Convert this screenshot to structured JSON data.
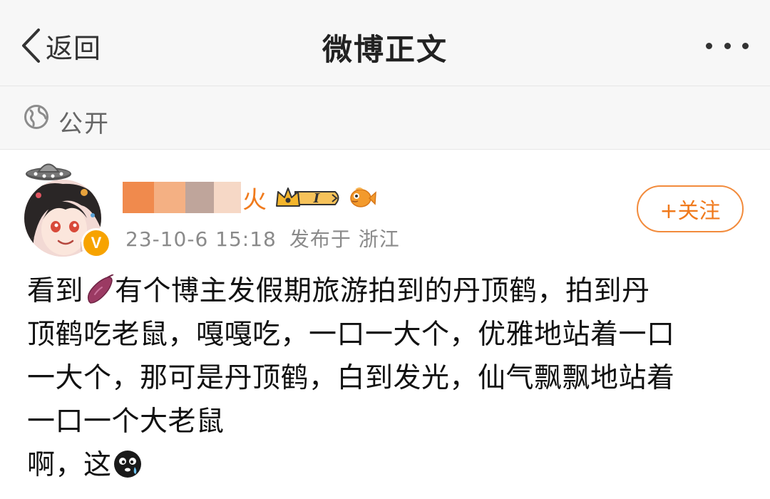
{
  "nav": {
    "back_label": "返回",
    "title": "微博正文",
    "back_icon": "chevron-left-icon",
    "more_icon": "more-dots-icon"
  },
  "visibility": {
    "icon": "globe-icon",
    "label": "公开"
  },
  "post": {
    "author": {
      "name_visible_tail": "火",
      "badges": [
        "crown-level-badge",
        "fish-badge"
      ],
      "level_label": "I",
      "verified_icon": "verified-v-badge"
    },
    "meta": {
      "time": "23-10-6 15:18",
      "location": "发布于 浙江"
    },
    "follow_button": "+关注",
    "content": {
      "line1_a": "看到",
      "line1_b": "有个博主发假期旅游拍到的丹顶鹤，拍到丹",
      "line2": "顶鹤吃老鼠，嘎嘎吃，一口一大个，优雅地站着一口",
      "line3": "一大个，那可是丹顶鹤，白到发光，仙气飘飘地站着",
      "line4": "一口一个大老鼠",
      "line5": "啊，这"
    },
    "emojis": [
      "sweet-potato-emoji",
      "crying-face-emoji"
    ]
  },
  "colors": {
    "accent": "#f07a1c",
    "nav_bg": "#f7f7f7",
    "meta_text": "#8a8a8a"
  }
}
